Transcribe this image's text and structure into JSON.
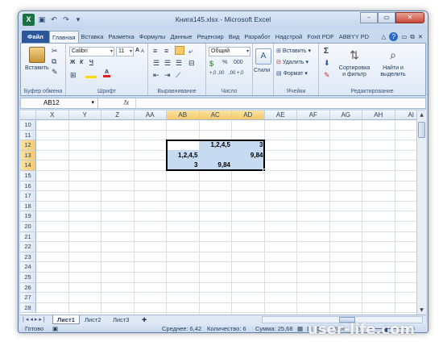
{
  "window": {
    "title": "Книга145.xlsx - Microsoft Excel",
    "controls": [
      "–",
      "▭",
      "✕"
    ]
  },
  "tabs": [
    "Файл",
    "Главная",
    "Вставка",
    "Разметка",
    "Формулы",
    "Данные",
    "Рецензир",
    "Вид",
    "Разработ",
    "Надстрой",
    "Foxit PDF",
    "ABBYY PD"
  ],
  "active_tab": "Главная",
  "ribbon": {
    "clipboard": {
      "label": "Буфер обмена",
      "paste": "Вставить"
    },
    "font": {
      "label": "Шрифт",
      "name": "Calibri",
      "size": "11",
      "bold": "Ж",
      "italic": "К",
      "underline": "Ч",
      "grow": "A",
      "shrink": "A"
    },
    "alignment": {
      "label": "Выравнивание"
    },
    "number": {
      "label": "Число",
      "format": "Общий",
      "percent": "%",
      "thousands": "000",
      "inc_dec": "+,0 ,00",
      "dec_dec": ",00 +,0"
    },
    "styles": {
      "label": "Стили"
    },
    "cells": {
      "label": "Ячейки",
      "insert": "Вставить",
      "delete": "Удалить",
      "format": "Формат"
    },
    "editing": {
      "label": "Редактирование",
      "sum": "Σ",
      "sort": "Сортировка и фильтр",
      "find": "Найти и выделить"
    }
  },
  "formula_bar": {
    "name_box": "AB12",
    "fx": "fx",
    "formula": ""
  },
  "columns": [
    "X",
    "Y",
    "Z",
    "AA",
    "AB",
    "AC",
    "AD",
    "AE",
    "AF",
    "AG",
    "AH",
    "AI"
  ],
  "selected_columns": [
    "AB",
    "AC",
    "AD"
  ],
  "rows": [
    "10",
    "11",
    "12",
    "13",
    "14",
    "15",
    "16",
    "17",
    "18",
    "19",
    "20",
    "21",
    "22",
    "23",
    "24",
    "25",
    "26",
    "27",
    "28"
  ],
  "selected_rows": [
    "12",
    "13",
    "14"
  ],
  "cells": {
    "AC12": "1,2,4,5",
    "AD12": "3",
    "AB13": "1,2,4,5",
    "AD13": "9,84",
    "AB14": "3",
    "AC14": "9,84"
  },
  "sheets": [
    "Лист1",
    "Лист2",
    "Лист3"
  ],
  "active_sheet": "Лист1",
  "status": {
    "mode": "Готово",
    "average": "Среднее: 6,42",
    "count": "Количество: 6",
    "sum": "Сумма: 25,68",
    "zoom": "100%"
  },
  "watermark": "user-life.com"
}
